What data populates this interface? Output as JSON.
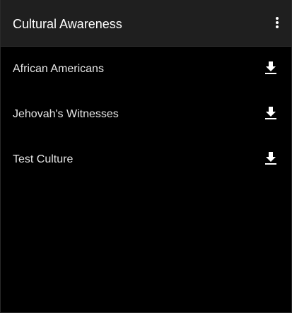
{
  "toolbar": {
    "title": "Cultural Awareness",
    "menu_icon": "more-vertical-icon"
  },
  "list": {
    "items": [
      {
        "label": "African Americans",
        "action_icon": "download-icon"
      },
      {
        "label": "Jehovah's Witnesses",
        "action_icon": "download-icon"
      },
      {
        "label": "Test Culture",
        "action_icon": "download-icon"
      }
    ]
  },
  "colors": {
    "background": "#000000",
    "toolbar_background": "#1f1f1f",
    "text_primary": "#ffffff",
    "text_secondary": "#e6e6e6"
  }
}
